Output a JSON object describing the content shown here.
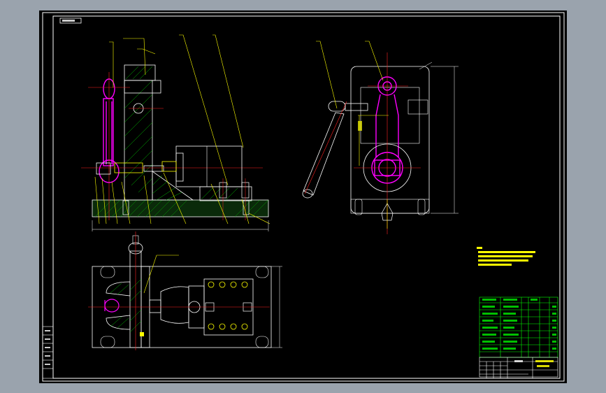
{
  "drawing": {
    "background": "#000000",
    "outer_bg": "#9aa3ad",
    "colors": {
      "border": "#ffffff",
      "centerline": "#ff2020",
      "leader": "#ffff00",
      "part": "#ff00ff",
      "hatch": "#00c000",
      "dim": "#ffffff",
      "table_line": "#00ff00",
      "table_text": "#00ff00"
    },
    "title_tag": "",
    "notes_label": "",
    "title_block_name": ""
  }
}
